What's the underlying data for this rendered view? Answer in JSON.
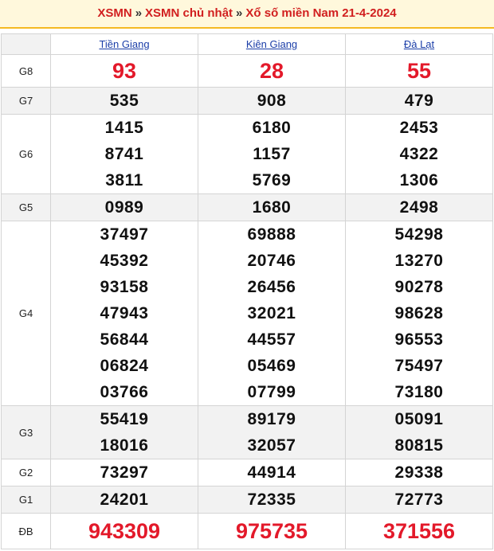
{
  "header": {
    "link1": "XSMN",
    "sep1": "»",
    "link2": "XSMN chủ nhật",
    "sep2": "»",
    "link3": "Xổ số miền Nam 21-4-2024"
  },
  "provinces": [
    "Tiền Giang",
    "Kiên Giang",
    "Đà Lạt"
  ],
  "rows": [
    {
      "label": "G8",
      "values": [
        [
          "93"
        ],
        [
          "28"
        ],
        [
          "55"
        ]
      ]
    },
    {
      "label": "G7",
      "values": [
        [
          "535"
        ],
        [
          "908"
        ],
        [
          "479"
        ]
      ]
    },
    {
      "label": "G6",
      "values": [
        [
          "1415",
          "8741",
          "3811"
        ],
        [
          "6180",
          "1157",
          "5769"
        ],
        [
          "2453",
          "4322",
          "1306"
        ]
      ]
    },
    {
      "label": "G5",
      "values": [
        [
          "0989"
        ],
        [
          "1680"
        ],
        [
          "2498"
        ]
      ]
    },
    {
      "label": "G4",
      "values": [
        [
          "37497",
          "45392",
          "93158",
          "47943",
          "56844",
          "06824",
          "03766"
        ],
        [
          "69888",
          "20746",
          "26456",
          "32021",
          "44557",
          "05469",
          "07799"
        ],
        [
          "54298",
          "13270",
          "90278",
          "98628",
          "96553",
          "75497",
          "73180"
        ]
      ]
    },
    {
      "label": "G3",
      "values": [
        [
          "55419",
          "18016"
        ],
        [
          "89179",
          "32057"
        ],
        [
          "05091",
          "80815"
        ]
      ]
    },
    {
      "label": "G2",
      "values": [
        [
          "73297"
        ],
        [
          "44914"
        ],
        [
          "29338"
        ]
      ]
    },
    {
      "label": "G1",
      "values": [
        [
          "24201"
        ],
        [
          "72335"
        ],
        [
          "72773"
        ]
      ]
    },
    {
      "label": "ĐB",
      "values": [
        [
          "943309"
        ],
        [
          "975735"
        ],
        [
          "371556"
        ]
      ]
    }
  ],
  "colors": {
    "accent_red": "#e3192a",
    "link_blue": "#1b3ea8",
    "header_bg": "#fff8dc"
  }
}
